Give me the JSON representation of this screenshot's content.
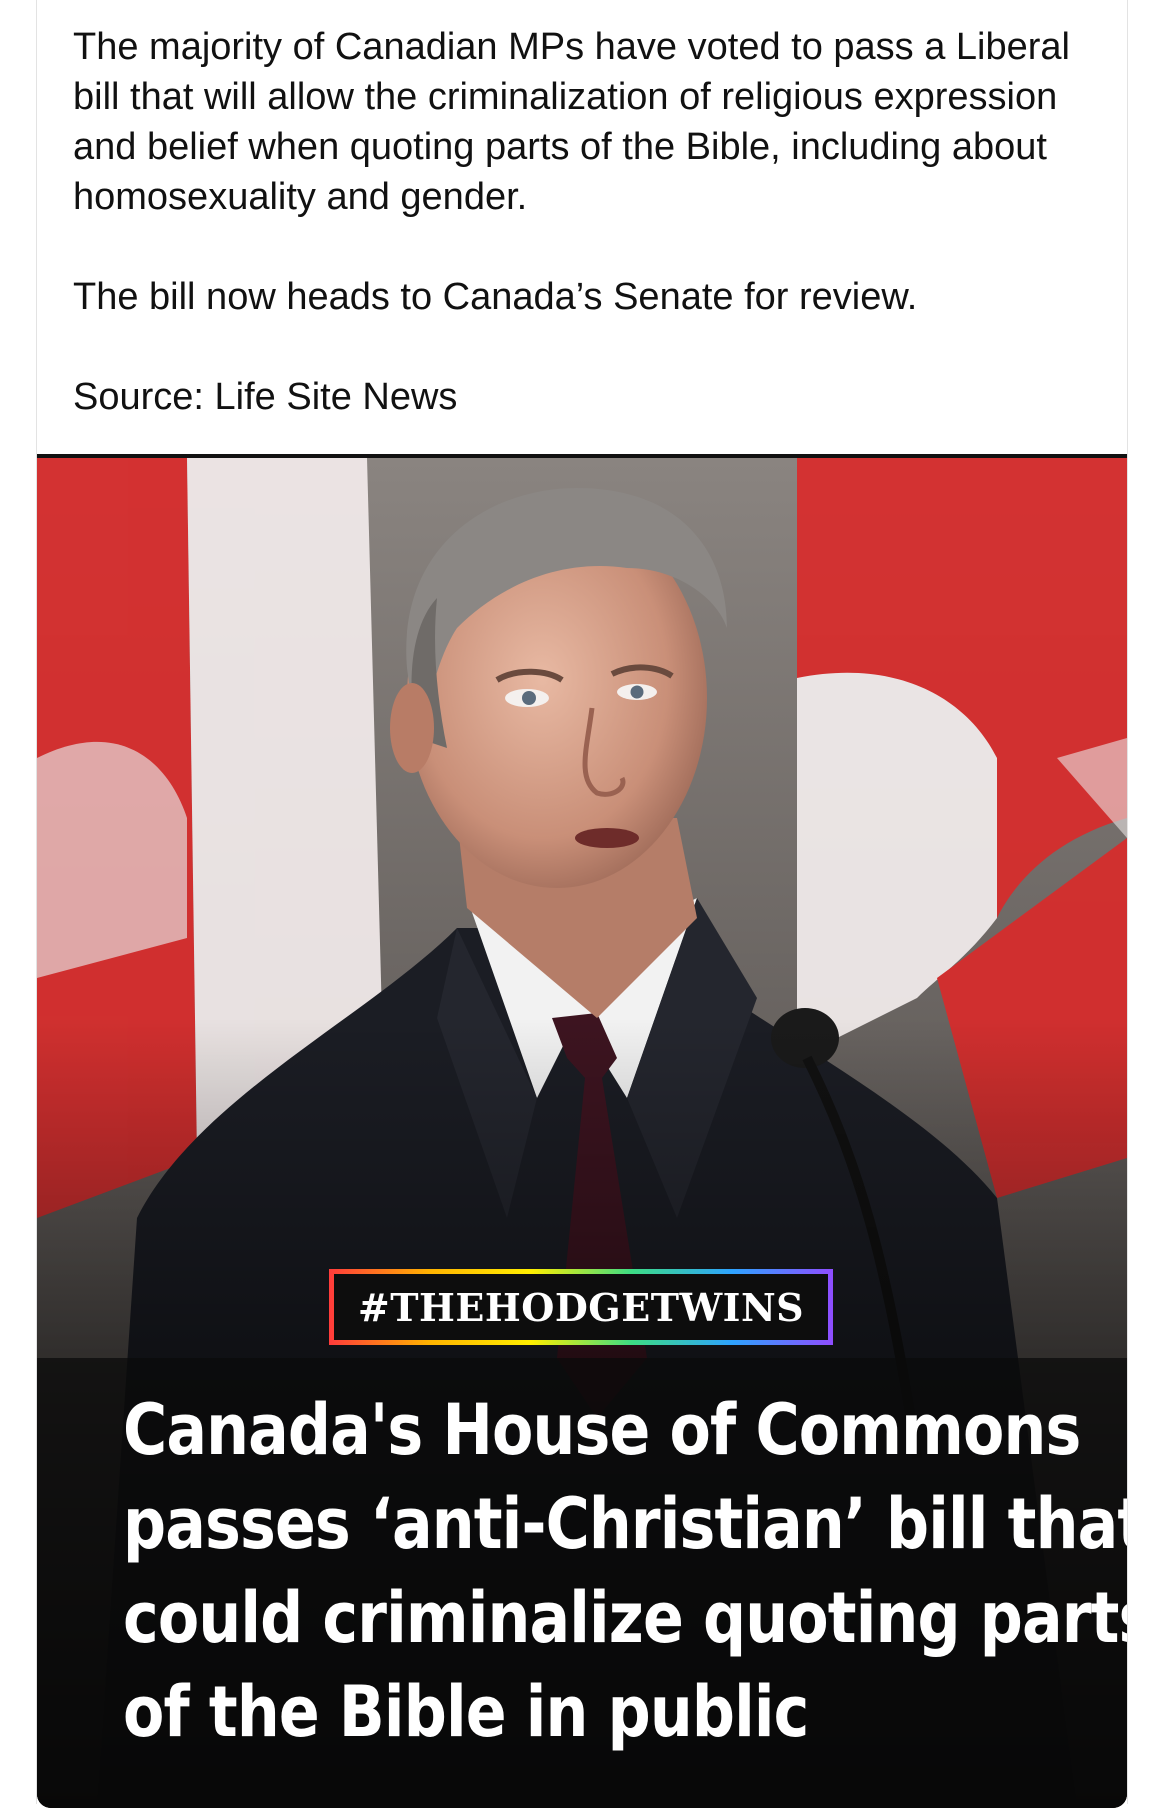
{
  "post": {
    "paragraphs": [
      "The majority of Canadian MPs have voted to pass a Liberal bill that will allow the criminalization of religious expression and belief when quoting parts of the Bible, including about homosexuality and gender.",
      "The bill now heads to Canada’s Senate for review.",
      "Source: Life Site News"
    ]
  },
  "image": {
    "hashtag": "#THEHODGETWINS",
    "headline_lines": [
      "Canada's House of Commons",
      "passes ‘anti-Christian’ bill that",
      "could criminalize quoting parts",
      "of the Bible in public"
    ],
    "colors": {
      "flag_red": "#d92b2b",
      "flag_white": "#f4eeee",
      "overlay": "#0b0b0b"
    }
  }
}
